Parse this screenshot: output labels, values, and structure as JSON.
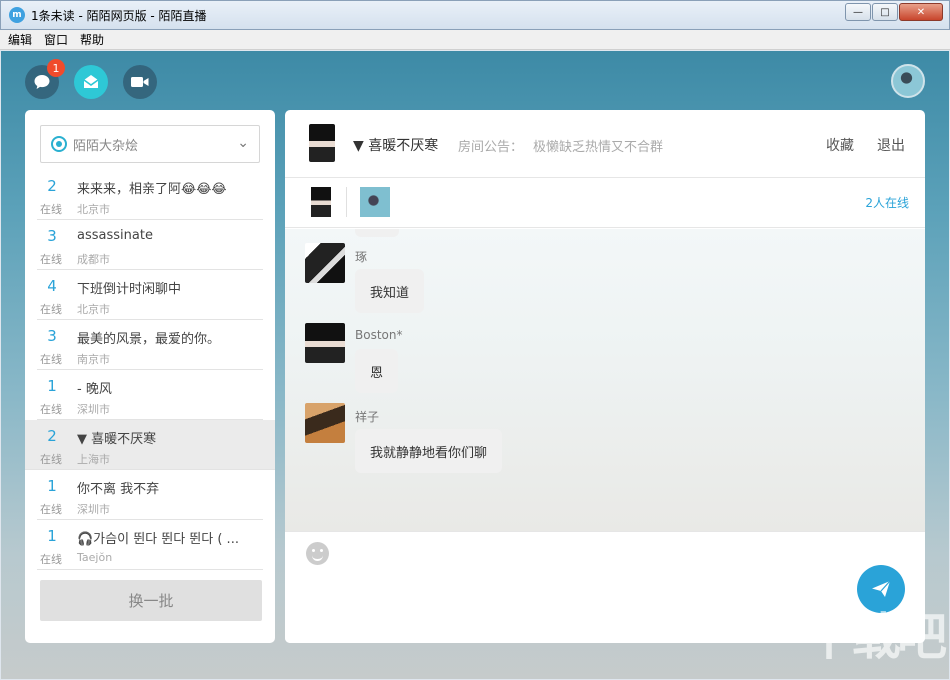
{
  "window": {
    "title": "1条未读 - 陌陌网页版 - 陌陌直播",
    "app_icon_glyph": "m",
    "controls": {
      "minimize": "—",
      "maximize": "□",
      "close": "✕"
    }
  },
  "menu": {
    "items": [
      "编辑",
      "窗口",
      "帮助"
    ]
  },
  "toolbar": {
    "unread_badge": "1"
  },
  "left": {
    "room_selector": "陌陌大杂烩",
    "rooms": [
      {
        "count": "2",
        "status": "在线",
        "name": "来来来，相亲了阿😂😂😂",
        "city": "北京市"
      },
      {
        "count": "3",
        "status": "在线",
        "name": "assassinate",
        "city": "成都市"
      },
      {
        "count": "4",
        "status": "在线",
        "name": "下班倒计时闲聊中",
        "city": "北京市"
      },
      {
        "count": "3",
        "status": "在线",
        "name": "最美的风景，最爱的你。",
        "city": "南京市"
      },
      {
        "count": "1",
        "status": "在线",
        "name": "- 晚风",
        "city": "深圳市"
      },
      {
        "count": "2",
        "status": "在线",
        "name": "▼ 喜暖不厌寒",
        "city": "上海市"
      },
      {
        "count": "1",
        "status": "在线",
        "name": "你不离 我不弃",
        "city": "深圳市"
      },
      {
        "count": "1",
        "status": "在线",
        "name": "🎧가슴이 뛴다 뛴다 뛴다 ( ...",
        "city": "Taejŏn"
      }
    ],
    "refresh_button": "换一批"
  },
  "chat": {
    "room_title": "▼ 喜暖不厌寒",
    "notice_label": "房间公告：",
    "notice_text": "极懒缺乏热情又不合群",
    "favorite": "收藏",
    "exit": "退出",
    "online_count": "2人在线",
    "messages": [
      {
        "nick": "琢",
        "text": "我知道"
      },
      {
        "nick": "Boston*",
        "text": "恩"
      },
      {
        "nick": "祥子",
        "text": "我就静静地看你们聊"
      }
    ]
  },
  "watermark": "下载吧",
  "colors": {
    "accent": "#2aa3d8",
    "badge": "#f04b2c",
    "teal": "#2ec8d6"
  }
}
